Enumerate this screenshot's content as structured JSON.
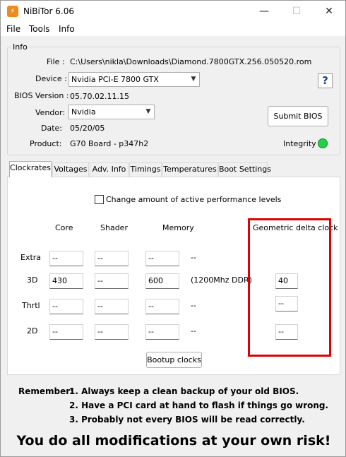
{
  "window": {
    "title": "NiBiTor 6.06",
    "minimize": "—",
    "maximize": "☐",
    "close": "✕"
  },
  "menu": [
    "File",
    "Tools",
    "Info"
  ],
  "info": {
    "group_label": "Info",
    "file_label": "File :",
    "file_value": "C:\\Users\\nikla\\Downloads\\Diamond.7800GTX.256.050520.rom",
    "device_label": "Device :",
    "device_value": "Nvidia PCI-E 7800 GTX",
    "bios_label": "BIOS Version :",
    "bios_value": "05.70.02.11.15",
    "vendor_label": "Vendor:",
    "vendor_value": "Nvidia",
    "date_label": "Date:",
    "date_value": "05/20/05",
    "product_label": "Product:",
    "product_value": "G70 Board - p347h2",
    "help": "?",
    "submit": "Submit BIOS",
    "integrity_label": "Integrity :",
    "integrity_color": "#22d04a"
  },
  "tabs": [
    "Clockrates",
    "Voltages",
    "Adv. Info",
    "Timings",
    "Temperatures",
    "Boot Settings"
  ],
  "clockrates": {
    "checkbox_label": "Change amount of active performance levels",
    "col_core": "Core",
    "col_shader": "Shader",
    "col_memory": "Memory",
    "col_geo": "Geometric delta clock",
    "rows": [
      {
        "label": "Extra",
        "core": "--",
        "shader": "--",
        "memory": "--",
        "info": "--",
        "geo": ""
      },
      {
        "label": "3D",
        "core": "430",
        "shader": "--",
        "memory": "600",
        "info": "(1200Mhz DDR)",
        "geo": "40"
      },
      {
        "label": "Thrtl",
        "core": "--",
        "shader": "--",
        "memory": "--",
        "info": "--",
        "geo": "--"
      },
      {
        "label": "2D",
        "core": "--",
        "shader": "--",
        "memory": "--",
        "info": "--",
        "geo": "--"
      }
    ],
    "bootup": "Bootup clocks",
    "highlight_color": "#e00000"
  },
  "remember": {
    "label": "Remember:",
    "line1": "1. Always keep a clean backup of your old BIOS.",
    "line2": "2. Have a PCI card at hand to flash if things go wrong.",
    "line3": "3. Probably not every BIOS will be read correctly."
  },
  "warning": "You do all modifications at your own risk!"
}
